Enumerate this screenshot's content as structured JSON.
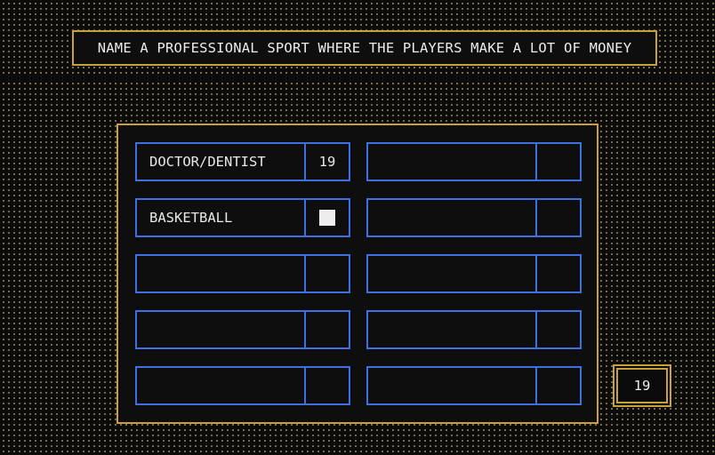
{
  "question": {
    "text": "NAME A PROFESSIONAL SPORT WHERE THE PLAYERS MAKE A LOT OF MONEY"
  },
  "answers": [
    {
      "answer": "DOCTOR/DENTIST",
      "points": "19",
      "state": "revealed"
    },
    {
      "answer": "",
      "points": "",
      "state": "hidden"
    },
    {
      "answer": "BASKETBALL",
      "points": "",
      "state": "covered"
    },
    {
      "answer": "",
      "points": "",
      "state": "hidden"
    },
    {
      "answer": "",
      "points": "",
      "state": "hidden"
    },
    {
      "answer": "",
      "points": "",
      "state": "hidden"
    },
    {
      "answer": "",
      "points": "",
      "state": "hidden"
    },
    {
      "answer": "",
      "points": "",
      "state": "hidden"
    },
    {
      "answer": "",
      "points": "",
      "state": "hidden"
    },
    {
      "answer": "",
      "points": "",
      "state": "hidden"
    }
  ],
  "score": {
    "value": "19"
  },
  "colors": {
    "background": "#0b0b0b",
    "frame": "#c9a13b",
    "slot_border": "#3f6fe0",
    "text": "#e8e8e8",
    "dots": "#8a7a4a"
  }
}
